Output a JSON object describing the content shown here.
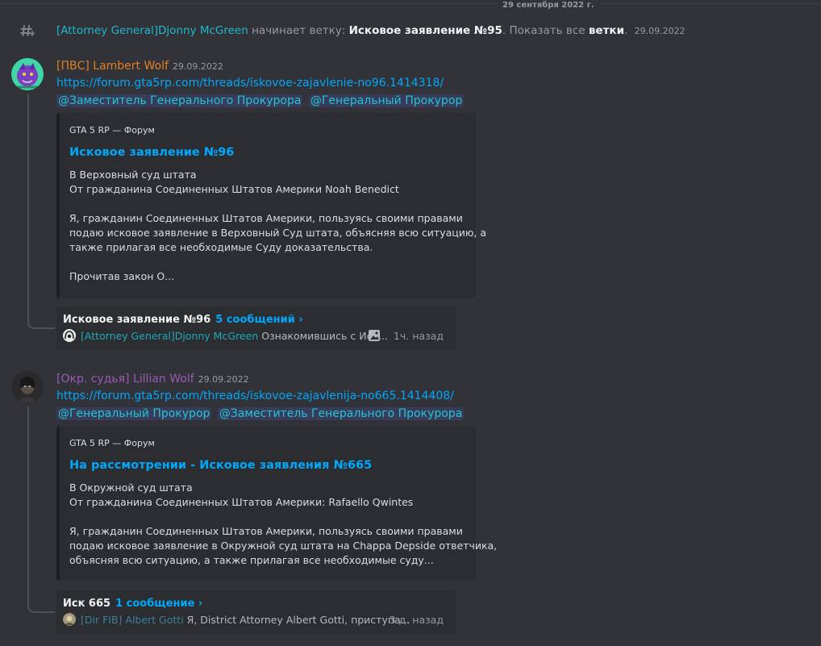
{
  "date_divider": "29 сентября 2022 г.",
  "system_message": {
    "user": "[Attorney General]Djonny McGreen",
    "action": "начинает ветку:",
    "thread_name": "Исковое заявление №95",
    "show_all_prefix": ". Показать все",
    "show_all_link": "ветки",
    "suffix": ".",
    "time": "29.09.2022"
  },
  "messages": [
    {
      "author": "[ПВС] Lambert Wolf",
      "author_color": "#e67e22",
      "time": "29.09.2022",
      "link": "https://forum.gta5rp.com/threads/iskovoe-zajavlenie-no96.1414318/",
      "mentions": [
        "@Заместитель Генерального Прокурора",
        "@Генеральный Прокурор"
      ],
      "embed": {
        "provider": "GTA 5 RP — Форум",
        "title": "Исковое заявление №96",
        "lines": [
          "В Верховный суд штата",
          "От гражданина Соединенных Штатов Америки Noah Benedict",
          "",
          "Я, гражданин Соединенных Штатов Америки, пользуясь своими правами",
          "подаю исковое заявление в Верховный Суд штата, объясняя всю ситуацию, а",
          "также прилагая все необходимые Суду доказательства.",
          "",
          "Прочитав закон О..."
        ]
      },
      "thread": {
        "name": "Исковое заявление №96",
        "count": "5 сообщений ›",
        "last_user": "[Attorney General]Djonny McGreen",
        "preview": "Ознакомившись с Иск...",
        "ago": "1ч. назад",
        "has_image": true
      }
    },
    {
      "author": "[Окр. судья] Lillian Wolf",
      "author_color": "#9b59b6",
      "time": "29.09.2022",
      "link": "https://forum.gta5rp.com/threads/iskovoe-zajavlenija-no665.1414408/",
      "mentions": [
        "@Генеральный Прокурор",
        "@Заместитель Генерального Прокурора"
      ],
      "embed": {
        "provider": "GTA 5 RP — Форум",
        "title": "На рассмотрении - Исковое заявления №665",
        "lines": [
          "В Окружной суд штата",
          "От гражданина Соединенных Штатов Америки: Rafaello Qwintes",
          "",
          "Я, гражданин Соединенных Штатов Америки, пользуясь своими правами",
          "подаю исковое заявление в Окружной суд штата на Chappa Depside ответчика,",
          "объясняя всю ситуацию, а также прилагая все необходимые суду..."
        ]
      },
      "thread": {
        "name": "Иск 665",
        "count": "1 сообщение ›",
        "last_user": "[Dir FIB] Albert Gotti",
        "preview": "Я, District Attorney Albert Gotti, приступа...",
        "ago": "3 д. назад",
        "has_image": false
      }
    }
  ]
}
